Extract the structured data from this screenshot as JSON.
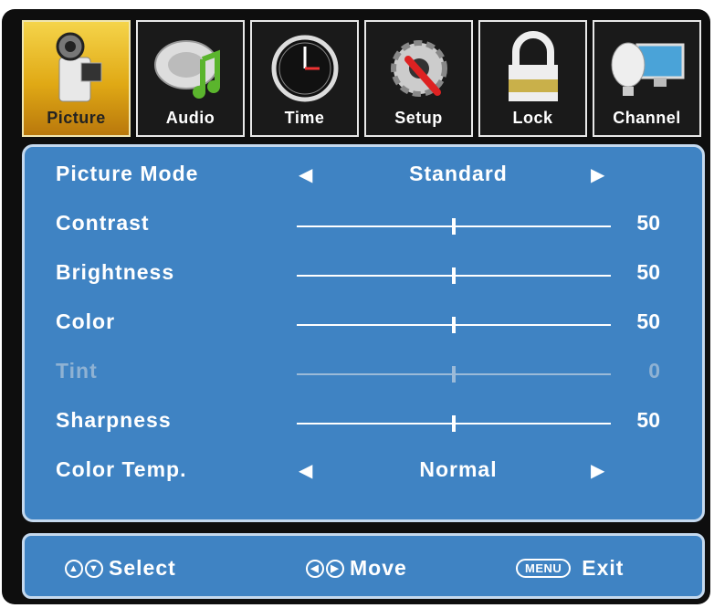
{
  "tabs": [
    {
      "label": "Picture",
      "icon": "camcorder-icon",
      "active": true
    },
    {
      "label": "Audio",
      "icon": "speaker-music-icon",
      "active": false
    },
    {
      "label": "Time",
      "icon": "clock-icon",
      "active": false
    },
    {
      "label": "Setup",
      "icon": "gear-wrench-icon",
      "active": false
    },
    {
      "label": "Lock",
      "icon": "padlock-icon",
      "active": false
    },
    {
      "label": "Channel",
      "icon": "satellite-monitor-icon",
      "active": false
    }
  ],
  "picture_settings": {
    "picture_mode": {
      "label": "Picture Mode",
      "value": "Standard"
    },
    "contrast": {
      "label": "Contrast",
      "value": "50",
      "level": 0.5
    },
    "brightness": {
      "label": "Brightness",
      "value": "50",
      "level": 0.5
    },
    "color": {
      "label": "Color",
      "value": "50",
      "level": 0.5
    },
    "tint": {
      "label": "Tint",
      "value": "0",
      "level": 0.5,
      "disabled": true
    },
    "sharpness": {
      "label": "Sharpness",
      "value": "50",
      "level": 0.5
    },
    "color_temp": {
      "label": "Color Temp.",
      "value": "Normal"
    }
  },
  "footer": {
    "select_label": "Select",
    "move_label": "Move",
    "menu_key": "MENU",
    "exit_label": "Exit"
  },
  "colors": {
    "panel": "#3f83c3",
    "active_tab": "#e0a915",
    "frame": "#0e0e0e"
  }
}
